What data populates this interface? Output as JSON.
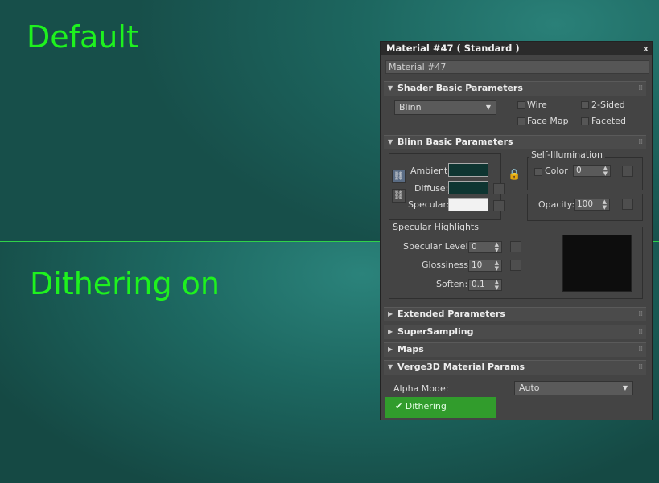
{
  "viewport": {
    "top_label": "Default",
    "bottom_label": "Dithering on",
    "divider_color": "#2fd24a",
    "label_color": "#1ef21e"
  },
  "material_editor": {
    "title": "Material #47  ( Standard )",
    "close_glyph": "x",
    "material_name": "Material #47",
    "shader_basic": {
      "header": "Shader Basic Parameters",
      "shader": "Blinn",
      "checkboxes": {
        "wire": "Wire",
        "two_sided": "2-Sided",
        "face_map": "Face Map",
        "faceted": "Faceted"
      }
    },
    "blinn_basic": {
      "header": "Blinn Basic Parameters",
      "ambient_label": "Ambient:",
      "diffuse_label": "Diffuse:",
      "specular_label": "Specular:",
      "ambient_color": "#0e3531",
      "diffuse_color": "#0e3531",
      "specular_color": "#f2f2f2",
      "self_illum_title": "Self-Illumination",
      "color_label": "Color",
      "self_illum_value": "0",
      "opacity_label": "Opacity:",
      "opacity_value": "100",
      "spec_highlights_title": "Specular Highlights",
      "spec_level_label": "Specular Level:",
      "spec_level_value": "0",
      "glossiness_label": "Glossiness:",
      "glossiness_value": "10",
      "soften_label": "Soften:",
      "soften_value": "0.1"
    },
    "rollouts": {
      "extended": "Extended Parameters",
      "supersampling": "SuperSampling",
      "maps": "Maps"
    },
    "verge3d": {
      "header": "Verge3D Material Params",
      "alpha_mode_label": "Alpha Mode:",
      "alpha_mode_value": "Auto",
      "dithering_label": "Dithering",
      "dithering_check": "✔"
    }
  }
}
